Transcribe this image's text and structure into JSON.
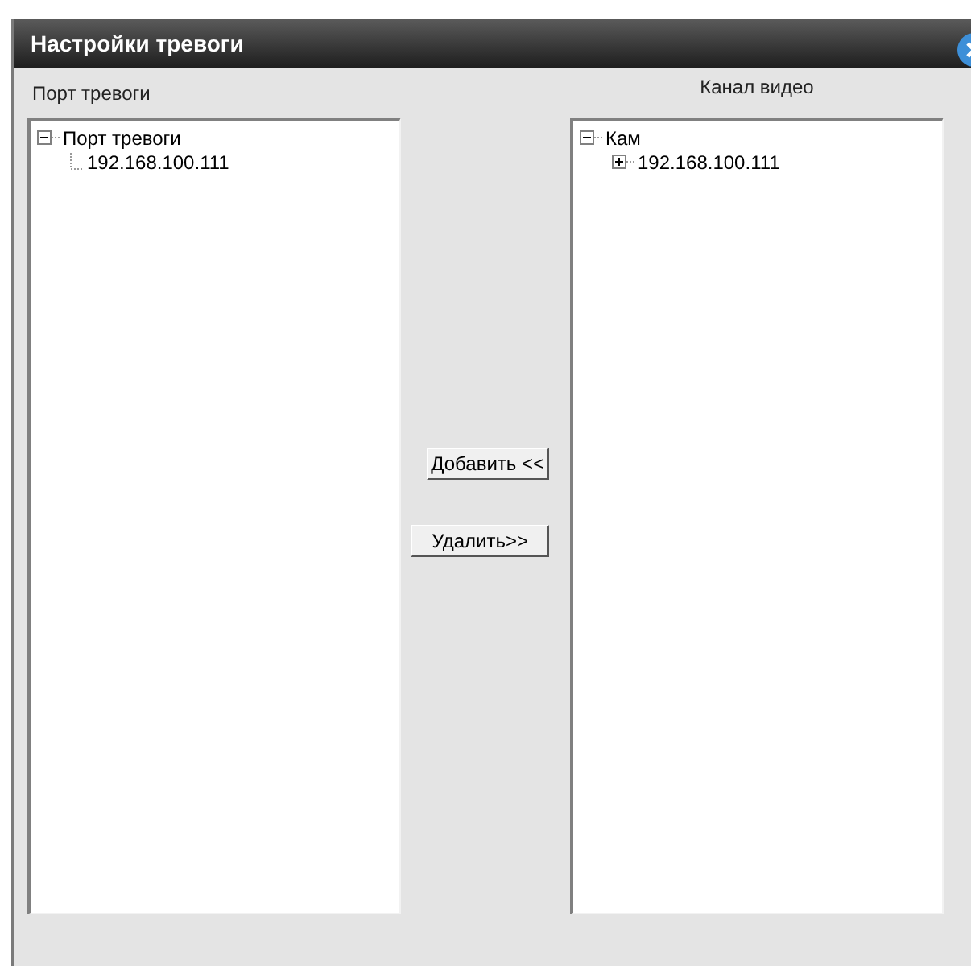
{
  "window": {
    "title": "Настройки тревоги"
  },
  "left_panel": {
    "label": "Порт тревоги",
    "tree": [
      {
        "label": "Порт тревоги",
        "kind": "node",
        "expanded": true,
        "children": [
          {
            "label": "192.168.100.111",
            "kind": "leaf"
          }
        ]
      }
    ]
  },
  "buttons": [
    {
      "label": "Добавить <<"
    },
    {
      "label": "Удалить>>"
    }
  ],
  "right_panel": {
    "label": "Канал видео",
    "tree": [
      {
        "label": "Кам",
        "kind": "node",
        "expanded": true,
        "children": [
          {
            "label": "192.168.100.111",
            "kind": "node",
            "expanded": false
          }
        ]
      }
    ]
  }
}
